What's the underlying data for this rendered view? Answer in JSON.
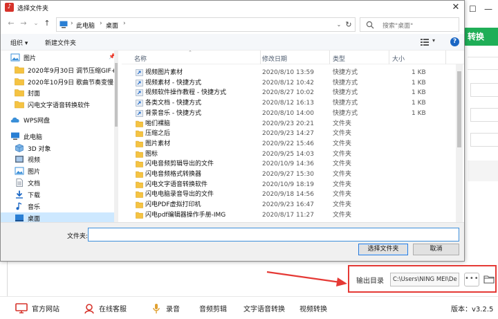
{
  "dialog": {
    "title": "选择文件夹",
    "close_label": "✕",
    "nav": {
      "back": "←",
      "forward": "→",
      "dropdown": "⌄",
      "up": "↑",
      "breadcrumb": [
        "此电脑",
        "桌面"
      ],
      "search_placeholder": "搜索\"桌面\""
    },
    "toolbar": {
      "organize": "组织 ▾",
      "new_folder": "新建文件夹"
    },
    "tree": [
      {
        "label": "图片",
        "icon": "pictures-icon",
        "pinned": true
      },
      {
        "label": "2020年9月30日 调节压缩GIF+W",
        "icon": "folder-icon"
      },
      {
        "label": "2020年10月9日 歌曲节奏变慢+E",
        "icon": "folder-icon"
      },
      {
        "label": "封面",
        "icon": "folder-icon"
      },
      {
        "label": "闪电文字语音转换软件",
        "icon": "folder-icon"
      },
      {
        "label": "WPS网盘",
        "icon": "cloud-icon"
      },
      {
        "label": "此电脑",
        "icon": "computer-icon"
      },
      {
        "label": "3D 对象",
        "icon": "cube-icon"
      },
      {
        "label": "视频",
        "icon": "video-icon"
      },
      {
        "label": "图片",
        "icon": "pictures-icon"
      },
      {
        "label": "文档",
        "icon": "document-icon"
      },
      {
        "label": "下载",
        "icon": "download-icon"
      },
      {
        "label": "音乐",
        "icon": "music-icon"
      },
      {
        "label": "桌面",
        "icon": "desktop-icon",
        "selected": true
      }
    ],
    "columns": {
      "name": "名称",
      "date": "修改日期",
      "type": "类型",
      "size": "大小"
    },
    "files": [
      {
        "name": "视频图片素材",
        "date": "2020/8/10 13:59",
        "type": "快捷方式",
        "size": "1 KB",
        "kind": "shortcut"
      },
      {
        "name": "视频素材 - 快捷方式",
        "date": "2020/8/12 10:42",
        "type": "快捷方式",
        "size": "1 KB",
        "kind": "shortcut"
      },
      {
        "name": "视频软件操作教程 - 快捷方式",
        "date": "2020/8/27 10:02",
        "type": "快捷方式",
        "size": "1 KB",
        "kind": "shortcut"
      },
      {
        "name": "各类文档 - 快捷方式",
        "date": "2020/8/12 16:13",
        "type": "快捷方式",
        "size": "1 KB",
        "kind": "shortcut"
      },
      {
        "name": "背景音乐 - 快捷方式",
        "date": "2020/8/10 14:00",
        "type": "快捷方式",
        "size": "1 KB",
        "kind": "shortcut"
      },
      {
        "name": "啪们裸脑",
        "date": "2020/9/23 20:21",
        "type": "文件夹",
        "size": "",
        "kind": "folder"
      },
      {
        "name": "压缩之后",
        "date": "2020/9/23 14:27",
        "type": "文件夹",
        "size": "",
        "kind": "folder"
      },
      {
        "name": "图片素材",
        "date": "2020/9/22 15:46",
        "type": "文件夹",
        "size": "",
        "kind": "folder"
      },
      {
        "name": "图标",
        "date": "2020/9/25 14:03",
        "type": "文件夹",
        "size": "",
        "kind": "folder"
      },
      {
        "name": "闪电音频剪辑导出的文件",
        "date": "2020/10/9 14:36",
        "type": "文件夹",
        "size": "",
        "kind": "folder"
      },
      {
        "name": "闪电音频格式转换器",
        "date": "2020/9/27 15:30",
        "type": "文件夹",
        "size": "",
        "kind": "folder"
      },
      {
        "name": "闪电文字语音转换软件",
        "date": "2020/10/9 18:19",
        "type": "文件夹",
        "size": "",
        "kind": "folder"
      },
      {
        "name": "闪电电脑录音导出的文件",
        "date": "2020/9/18 14:56",
        "type": "文件夹",
        "size": "",
        "kind": "folder"
      },
      {
        "name": "闪电PDF虚拟打印机",
        "date": "2020/9/23 16:47",
        "type": "文件夹",
        "size": "",
        "kind": "folder"
      },
      {
        "name": "闪电pdf编辑器操作手册-IMG",
        "date": "2020/8/17 11:27",
        "type": "文件夹",
        "size": "",
        "kind": "folder"
      }
    ],
    "folder_label": "文件夹:",
    "folder_value": "",
    "select_button": "选择文件夹",
    "cancel_button": "取消"
  },
  "app": {
    "convert_label": "转换",
    "minimize": "—",
    "restore": "☐",
    "output_label": "输出目录",
    "output_path": "C:\\Users\\NING MEI\\De",
    "more_label": "•••",
    "bottom_bar": [
      {
        "label": "官方网站",
        "icon": "monitor-icon"
      },
      {
        "label": "在线客服",
        "icon": "support-agent-icon"
      },
      {
        "label": "录音",
        "icon": "microphone-icon"
      },
      {
        "label": "音频剪辑",
        "icon": ""
      },
      {
        "label": "文字语音转换",
        "icon": ""
      },
      {
        "label": "视频转换",
        "icon": ""
      }
    ],
    "version": "版本：v3.2.5"
  },
  "colors": {
    "accent_green": "#1fae57",
    "highlight_red": "#e53935",
    "selection_blue": "#cde8ff",
    "link_blue": "#1a66c4"
  }
}
